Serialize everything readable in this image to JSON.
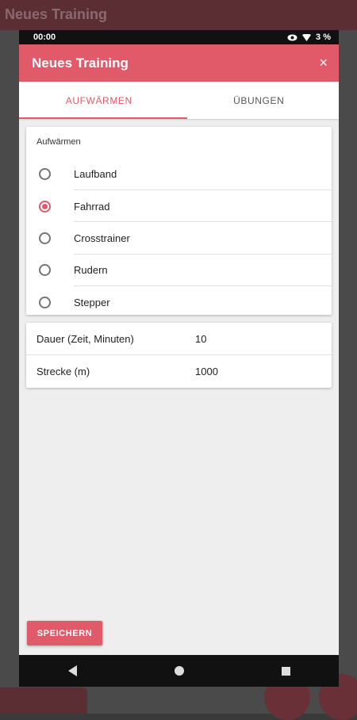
{
  "background": {
    "title": "Neues Training"
  },
  "statusbar": {
    "time": "00:00",
    "battery": "3 %"
  },
  "appbar": {
    "title": "Neues Training",
    "close": "×"
  },
  "tabs": [
    {
      "label": "AUFWÄRMEN",
      "active": true
    },
    {
      "label": "ÜBUNGEN",
      "active": false
    }
  ],
  "warmup": {
    "label": "Aufwärmen",
    "options": [
      {
        "label": "Laufband",
        "checked": false
      },
      {
        "label": "Fahrrad",
        "checked": true
      },
      {
        "label": "Crosstrainer",
        "checked": false
      },
      {
        "label": "Rudern",
        "checked": false
      },
      {
        "label": "Stepper",
        "checked": false
      }
    ]
  },
  "fields": [
    {
      "label": "Dauer (Zeit, Minuten)",
      "value": "10"
    },
    {
      "label": "Strecke (m)",
      "value": "1000"
    }
  ],
  "save_label": "SPEICHERN",
  "colors": {
    "accent": "#e05a6a",
    "statusbar": "#111111",
    "background": "#eeeeee"
  }
}
